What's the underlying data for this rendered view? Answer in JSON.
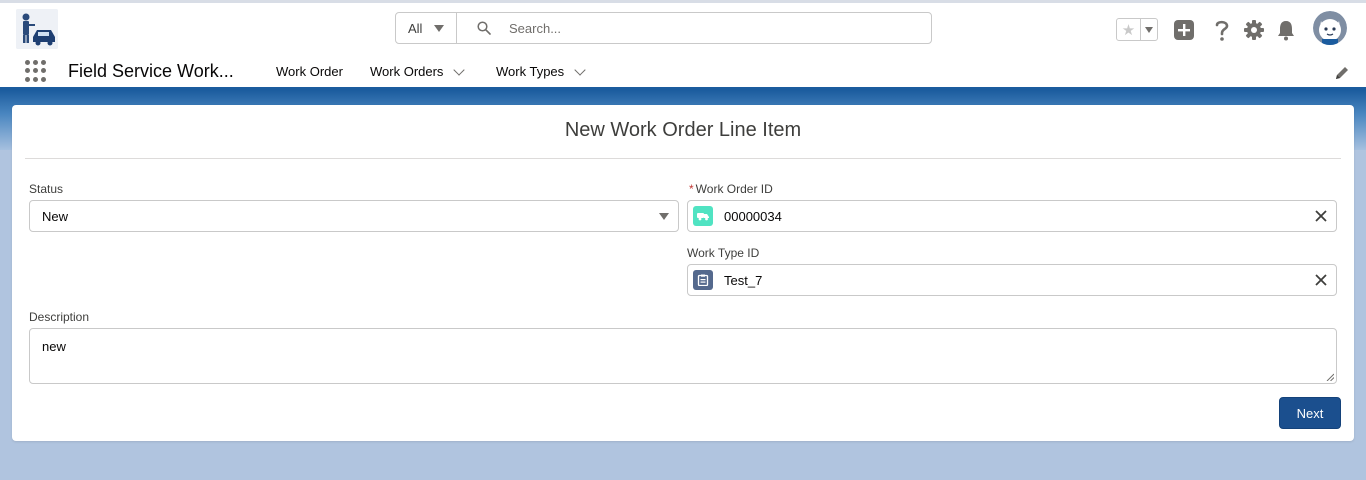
{
  "header": {
    "search_scope": "All",
    "search_placeholder": "Search...",
    "icons": [
      "favorites-star-icon",
      "add-icon",
      "help-icon",
      "setup-gear-icon",
      "notifications-bell-icon",
      "user-avatar"
    ]
  },
  "nav": {
    "app_name": "Field Service Work...",
    "items": [
      {
        "label": "Work Order",
        "has_dropdown": false
      },
      {
        "label": "Work Orders",
        "has_dropdown": true
      },
      {
        "label": "Work Types",
        "has_dropdown": true
      }
    ]
  },
  "form": {
    "title": "New Work Order Line Item",
    "status": {
      "label": "Status",
      "value": "New"
    },
    "work_order": {
      "label": "Work Order ID",
      "required_mark": "*",
      "value": "00000034",
      "icon": "work-order-icon",
      "icon_color": "#50e3c2"
    },
    "work_type": {
      "label": "Work Type ID",
      "value": "Test_7",
      "icon": "work-type-icon",
      "icon_color": "#54698d"
    },
    "description": {
      "label": "Description",
      "value": "new"
    },
    "next_label": "Next"
  },
  "colors": {
    "brand_blue": "#1b5c9e",
    "button_blue": "#1b4f8e",
    "page_bg": "#b0c4df"
  }
}
